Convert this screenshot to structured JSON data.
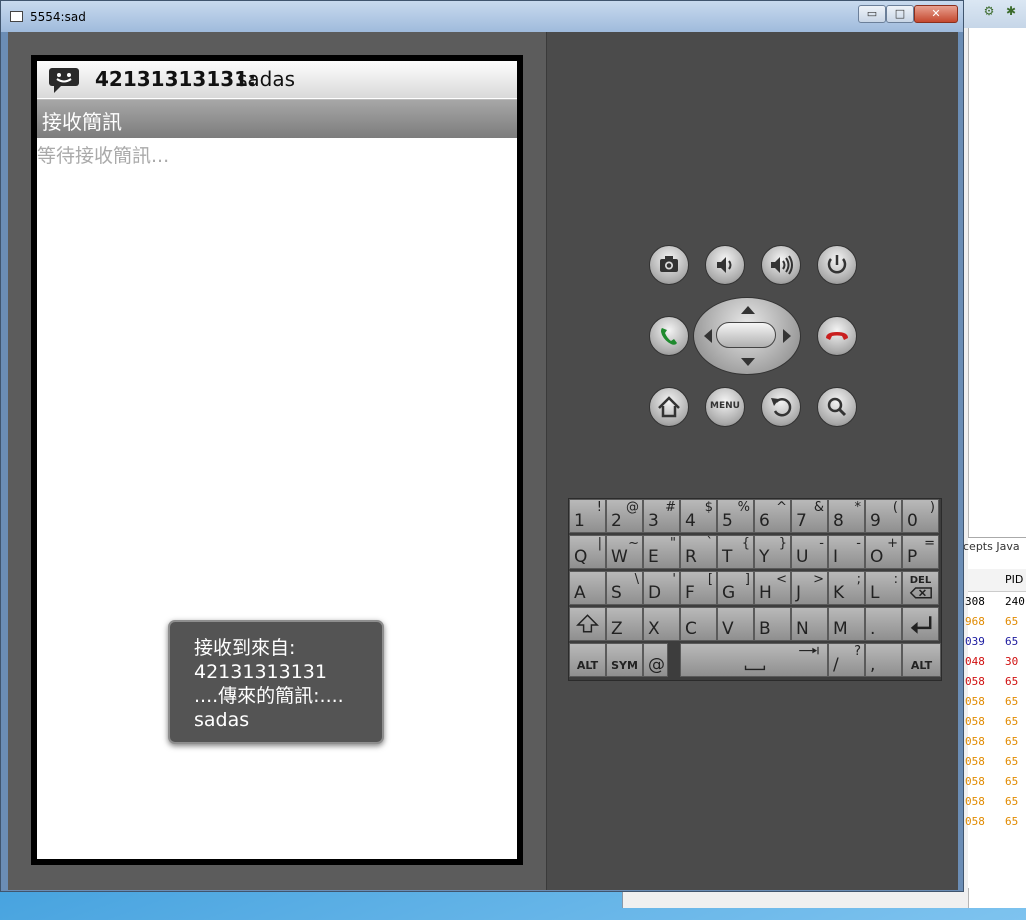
{
  "window": {
    "title": "5554:sad",
    "min": "▭",
    "max": "□",
    "close": "✕"
  },
  "notification": {
    "number": "42131313131:",
    "message": "sadas"
  },
  "app": {
    "title": "接收簡訊",
    "waiting": "等待接收簡訊..."
  },
  "toast": {
    "line1": "接收到來自:",
    "line2": "42131313131",
    "line3": "....傳來的簡訊:....",
    "line4": "sadas"
  },
  "controls": {
    "menu_label": "MENU"
  },
  "keyboard": {
    "row1": [
      [
        "1",
        "!"
      ],
      [
        "2",
        "@"
      ],
      [
        "3",
        "#"
      ],
      [
        "4",
        "$"
      ],
      [
        "5",
        "%"
      ],
      [
        "6",
        "^"
      ],
      [
        "7",
        "&"
      ],
      [
        "8",
        "*"
      ],
      [
        "9",
        "("
      ],
      [
        "0",
        ")"
      ]
    ],
    "row2": [
      [
        "Q",
        "|"
      ],
      [
        "W",
        "~"
      ],
      [
        "E",
        "\""
      ],
      [
        "R",
        "`"
      ],
      [
        "T",
        "{"
      ],
      [
        "Y",
        "}"
      ],
      [
        "U",
        "-"
      ],
      [
        "I",
        "-"
      ],
      [
        "O",
        "+"
      ],
      [
        "P",
        "="
      ]
    ],
    "row3": [
      [
        "A",
        ""
      ],
      [
        "S",
        "\\"
      ],
      [
        "D",
        "'"
      ],
      [
        "F",
        "["
      ],
      [
        "G",
        "]"
      ],
      [
        "H",
        "<"
      ],
      [
        "J",
        ">"
      ],
      [
        "K",
        ";"
      ],
      [
        "L",
        ":"
      ]
    ],
    "del_label": "DEL",
    "row4": [
      [
        "Z",
        ""
      ],
      [
        "X",
        ""
      ],
      [
        "C",
        ""
      ],
      [
        "V",
        ""
      ],
      [
        "B",
        ""
      ],
      [
        "N",
        ""
      ],
      [
        "M",
        ""
      ],
      [
        ".",
        ""
      ]
    ],
    "alt_label": "ALT",
    "sym_label": "SYM",
    "at_label": "@",
    "slash_label": "/",
    "slash_shift": "?",
    "comma_label": ","
  },
  "background_window": {
    "tab_label": "cepts Java",
    "pid_header": "PID",
    "log_rows": [
      {
        "a": "308",
        "b": "240",
        "ca": "#000000",
        "cb": "#000000"
      },
      {
        "a": "968",
        "b": "65",
        "ca": "#e08a00",
        "cb": "#e08a00"
      },
      {
        "a": "039",
        "b": "65",
        "ca": "#1a1aa0",
        "cb": "#1a1aa0"
      },
      {
        "a": "048",
        "b": "30",
        "ca": "#d01010",
        "cb": "#d01010"
      },
      {
        "a": "058",
        "b": "65",
        "ca": "#d01010",
        "cb": "#d01010"
      },
      {
        "a": "058",
        "b": "65",
        "ca": "#e08a00",
        "cb": "#e08a00"
      },
      {
        "a": "058",
        "b": "65",
        "ca": "#e08a00",
        "cb": "#e08a00"
      },
      {
        "a": "058",
        "b": "65",
        "ca": "#e08a00",
        "cb": "#e08a00"
      },
      {
        "a": "058",
        "b": "65",
        "ca": "#e08a00",
        "cb": "#e08a00"
      },
      {
        "a": "058",
        "b": "65",
        "ca": "#e08a00",
        "cb": "#e08a00"
      },
      {
        "a": "058",
        "b": "65",
        "ca": "#e08a00",
        "cb": "#e08a00"
      },
      {
        "a": "058",
        "b": "65",
        "ca": "#e08a00",
        "cb": "#e08a00"
      }
    ]
  }
}
